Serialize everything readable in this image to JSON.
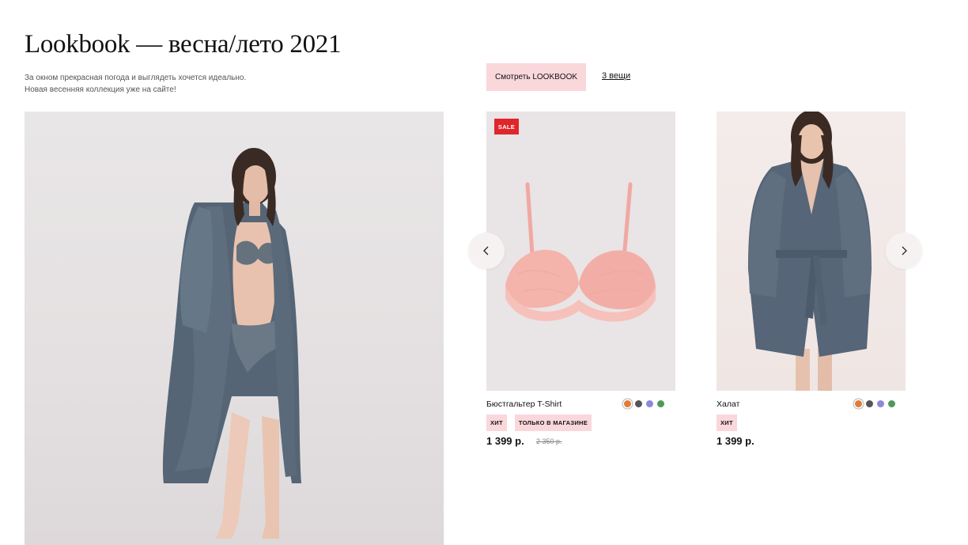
{
  "header": {
    "title": "Lookbook — весна/лето 2021",
    "subtitle_line1": "За окном прекрасная погода и выглядеть хочется идеально.",
    "subtitle_line2": "Новая весенняя коллекция уже на сайте!",
    "lookbook_button": "Смотреть LOOKBOOK",
    "items_link": "3 вещи"
  },
  "carousel": {
    "prev_icon": "chevron-left-icon",
    "next_icon": "chevron-right-icon"
  },
  "products": [
    {
      "name": "Бюстгальтер T-Shirt",
      "badge": "SALE",
      "badge_color": "#e0262b",
      "tags": [
        "ХИТ",
        "ТОЛЬКО В МАГАЗИНЕ"
      ],
      "price": "1 399 р.",
      "old_price": "2 350 р.",
      "colors": [
        "#e07b3a",
        "#555555",
        "#8b88dd",
        "#4e9a5c"
      ]
    },
    {
      "name": "Халат",
      "tags": [
        "ХИТ"
      ],
      "price": "1 399 р.",
      "colors": [
        "#e07b3a",
        "#555555",
        "#8b88dd",
        "#4e9a5c"
      ]
    }
  ],
  "colors": {
    "accent_pink": "#f9d7db",
    "sale_red": "#e0262b",
    "text": "#111111"
  }
}
